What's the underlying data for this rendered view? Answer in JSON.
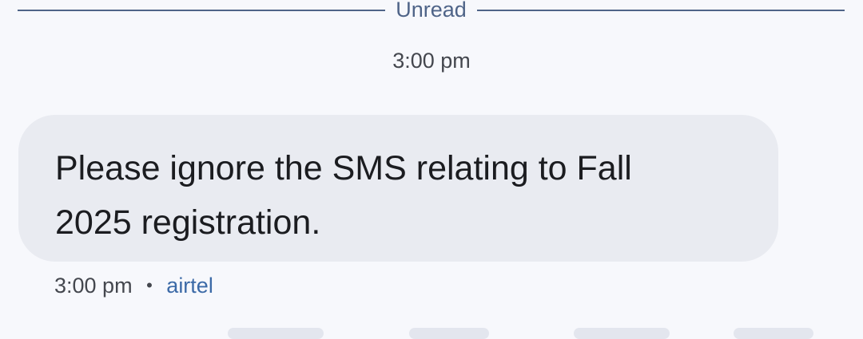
{
  "divider": {
    "label": "Unread"
  },
  "conversation": {
    "time_header": "3:00 pm",
    "messages": [
      {
        "text": "Please ignore the SMS relating to Fall 2025 registration.",
        "time": "3:00 pm",
        "separator": "•",
        "carrier": "airtel"
      }
    ]
  },
  "colors": {
    "background": "#f7f8fc",
    "bubble": "#e9ebf1",
    "divider": "#4f6488",
    "carrier_link": "#3c6aa7"
  }
}
